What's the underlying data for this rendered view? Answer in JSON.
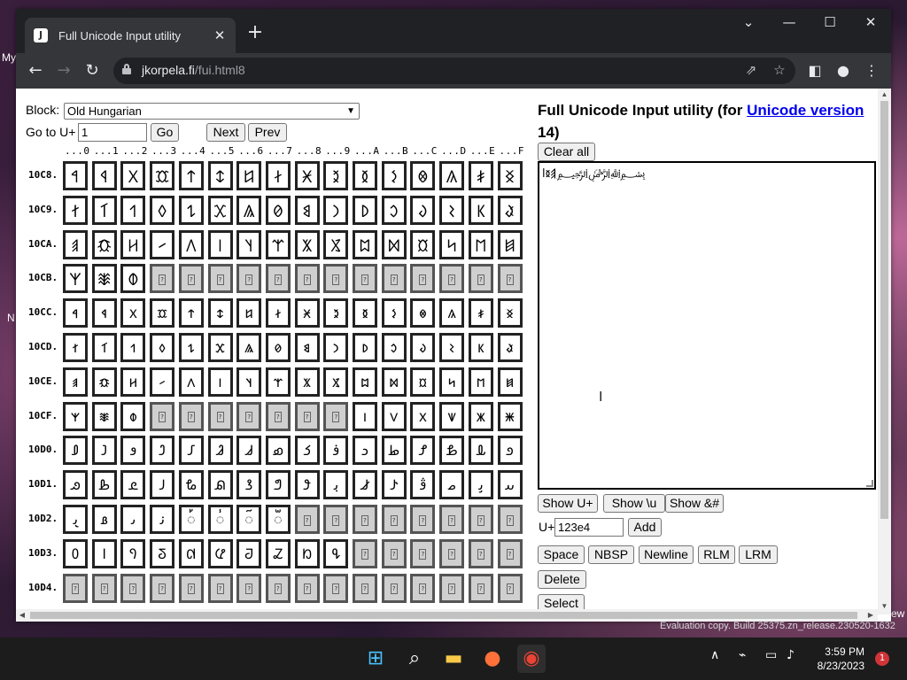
{
  "desktop": {
    "left_text_1": "My",
    "left_text_2": "N",
    "right_text": "ew",
    "watermark": "Evaluation copy. Build 25375.zn_release.230520-1632"
  },
  "browser": {
    "tab_title": "Full Unicode Input utility",
    "url_domain": "jkorpela.fi",
    "url_path": "/fui.html8"
  },
  "page": {
    "block_label": "Block:",
    "block_value": "Old Hungarian",
    "goto_label": "Go to U+",
    "goto_value": "1",
    "go_label": "Go",
    "next_label": "Next",
    "prev_label": "Prev",
    "title_prefix": "Full Unicode Input utility (for ",
    "title_link": "Unicode version",
    "title_suffix": "14)",
    "clear_all_label": "Clear all",
    "textarea_content": "𐲠𐳊ﺍ﷽ؚ",
    "show_uplus_label": "Show U+",
    "show_u_label": "Show \\u",
    "show_amp_label": "Show &#",
    "uplus_label": "U+",
    "uplus_value": "123e4",
    "add_label": "Add",
    "space_label": "Space",
    "nbsp_label": "NBSP",
    "newline_label": "Newline",
    "rlm_label": "RLM",
    "lrm_label": "LRM",
    "delete_label": "Delete",
    "select_label": "Select"
  },
  "grid": {
    "column_headers": [
      "...0",
      "...1",
      "...2",
      "...3",
      "...4",
      "...5",
      "...6",
      "...7",
      "...8",
      "...9",
      "...A",
      "...B",
      "...C",
      "...D",
      "...E",
      "...F"
    ],
    "rows": [
      {
        "label": "10C8.",
        "cells": [
          "𐲀",
          "𐲁",
          "𐲂",
          "𐲃",
          "𐲄",
          "𐲅",
          "𐲆",
          "𐲇",
          "𐲈",
          "𐲉",
          "𐲊",
          "𐲋",
          "𐲌",
          "𐲍",
          "𐲎",
          "𐲏"
        ]
      },
      {
        "label": "10C9.",
        "cells": [
          "𐲐",
          "𐲑",
          "𐲒",
          "𐲓",
          "𐲔",
          "𐲕",
          "𐲖",
          "𐲗",
          "𐲘",
          "𐲙",
          "𐲚",
          "𐲛",
          "𐲜",
          "𐲝",
          "𐲞",
          "𐲟"
        ]
      },
      {
        "label": "10CA.",
        "cells": [
          "𐲠",
          "𐲡",
          "𐲢",
          "𐲣",
          "𐲤",
          "𐲥",
          "𐲦",
          "𐲧",
          "𐲨",
          "𐲩",
          "𐲪",
          "𐲫",
          "𐲬",
          "𐲭",
          "𐲮",
          "𐲯"
        ]
      },
      {
        "label": "10CB.",
        "cells": [
          "𐲰",
          "𐲱",
          "𐲲",
          "",
          "",
          "",
          "",
          "",
          "",
          "",
          "",
          "",
          "",
          "",
          "",
          ""
        ]
      },
      {
        "label": "10CC.",
        "cells": [
          "𐳀",
          "𐳁",
          "𐳂",
          "𐳃",
          "𐳄",
          "𐳅",
          "𐳆",
          "𐳇",
          "𐳈",
          "𐳉",
          "𐳊",
          "𐳋",
          "𐳌",
          "𐳍",
          "𐳎",
          "𐳏"
        ]
      },
      {
        "label": "10CD.",
        "cells": [
          "𐳐",
          "𐳑",
          "𐳒",
          "𐳓",
          "𐳔",
          "𐳕",
          "𐳖",
          "𐳗",
          "𐳘",
          "𐳙",
          "𐳚",
          "𐳛",
          "𐳜",
          "𐳝",
          "𐳞",
          "𐳟"
        ]
      },
      {
        "label": "10CE.",
        "cells": [
          "𐳠",
          "𐳡",
          "𐳢",
          "𐳣",
          "𐳤",
          "𐳥",
          "𐳦",
          "𐳧",
          "𐳨",
          "𐳩",
          "𐳪",
          "𐳫",
          "𐳬",
          "𐳭",
          "𐳮",
          "𐳯"
        ]
      },
      {
        "label": "10CF.",
        "cells": [
          "𐳰",
          "𐳱",
          "𐳲",
          "",
          "",
          "",
          "",
          "",
          "",
          "",
          "𐳺",
          "𐳻",
          "𐳼",
          "𐳽",
          "𐳾",
          "𐳿"
        ]
      },
      {
        "label": "10D0.",
        "cells": [
          "𐴀",
          "𐴁",
          "𐴂",
          "𐴃",
          "𐴄",
          "𐴅",
          "𐴆",
          "𐴇",
          "𐴈",
          "𐴉",
          "𐴊",
          "𐴋",
          "𐴌",
          "𐴍",
          "𐴎",
          "𐴏"
        ]
      },
      {
        "label": "10D1.",
        "cells": [
          "𐴐",
          "𐴑",
          "𐴒",
          "𐴓",
          "𐴔",
          "𐴕",
          "𐴖",
          "𐴗",
          "𐴘",
          "𐴙",
          "𐴚",
          "𐴛",
          "𐴜",
          "𐴝",
          "𐴞",
          "𐴟"
        ]
      },
      {
        "label": "10D2.",
        "cells": [
          "𐴠",
          "𐴡",
          "𐴢",
          "𐴣",
          "𐴤",
          "𐴥",
          "𐴦",
          "𐴧",
          "",
          "",
          "",
          "",
          "",
          "",
          "",
          ""
        ]
      },
      {
        "label": "10D3.",
        "cells": [
          "𐴰",
          "𐴱",
          "𐴲",
          "𐴳",
          "𐴴",
          "𐴵",
          "𐴶",
          "𐴷",
          "𐴸",
          "𐴹",
          "",
          "",
          "",
          "",
          "",
          ""
        ]
      },
      {
        "label": "10D4.",
        "cells": [
          "",
          "",
          "",
          "",
          "",
          "",
          "",
          "",
          "",
          "",
          "",
          "",
          "",
          "",
          "",
          ""
        ]
      }
    ]
  },
  "taskbar": {
    "time": "3:59 PM",
    "date": "8/23/2023",
    "notification_count": "1"
  },
  "icons": [
    "tab-close-icon",
    "new-tab-icon",
    "back-icon",
    "forward-icon",
    "reload-icon",
    "lock-icon",
    "share-icon",
    "star-icon",
    "sidepanel-icon",
    "profile-icon",
    "menu-icon",
    "windows-start-icon",
    "search-icon",
    "file-explorer-icon",
    "firefox-icon",
    "chrome-icon"
  ]
}
